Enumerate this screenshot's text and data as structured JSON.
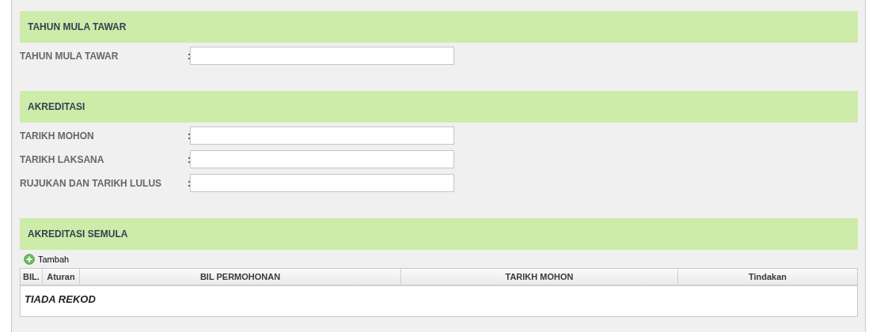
{
  "sections": [
    {
      "kind": "form",
      "title": "TAHUN MULA TAWAR",
      "fields": [
        {
          "label": "TAHUN MULA TAWAR",
          "separator": ":"
        }
      ]
    },
    {
      "kind": "form",
      "title": "AKREDITASI",
      "fields": [
        {
          "label": "TARIKH MOHON",
          "separator": ":"
        },
        {
          "label": "TARIKH LAKSANA",
          "separator": ":"
        },
        {
          "label": "RUJUKAN DAN TARIKH LULUS",
          "separator": ":"
        }
      ]
    },
    {
      "kind": "table",
      "title": "AKREDITASI SEMULA",
      "add_button": "Tambah",
      "columns": [
        "BIL.",
        "Aturan",
        "BIL PERMOHONAN",
        "TARIKH MOHON",
        "Tindakan"
      ],
      "empty_message": "TIADA REKOD"
    }
  ]
}
